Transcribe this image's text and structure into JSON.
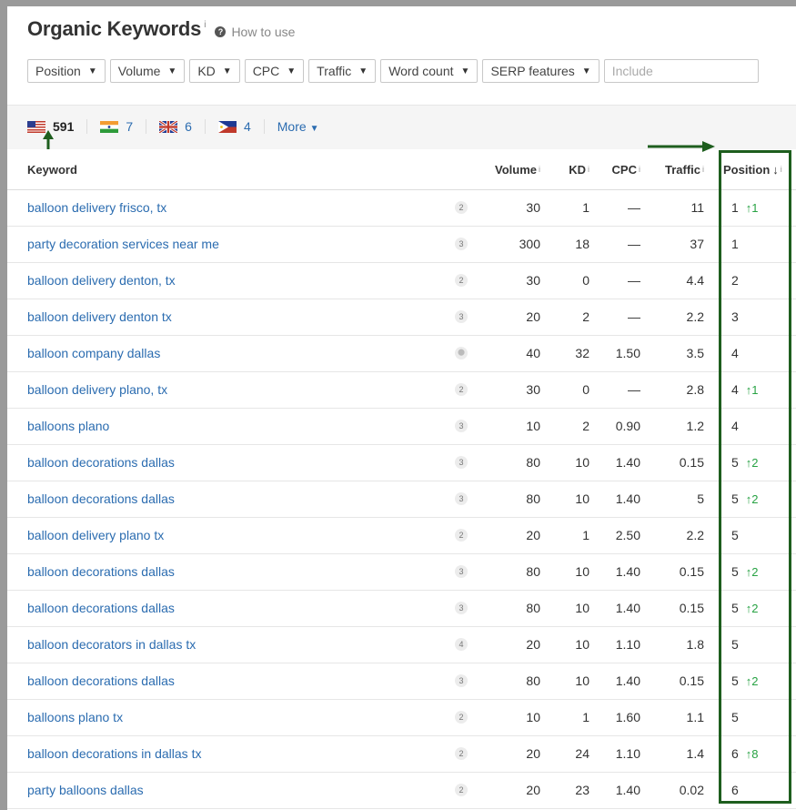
{
  "header": {
    "title": "Organic Keywords",
    "title_sup": "i",
    "help_icon": "?",
    "how_to_use": "How to use"
  },
  "filters": [
    "Position",
    "Volume",
    "KD",
    "CPC",
    "Traffic",
    "Word count",
    "SERP features"
  ],
  "include_placeholder": "Include",
  "countries": [
    {
      "flag": "us-flag-icon",
      "count": "591"
    },
    {
      "flag": "india-flag-icon",
      "count": "7"
    },
    {
      "flag": "uk-flag-icon",
      "count": "6"
    },
    {
      "flag": "philippines-flag-icon",
      "count": "4"
    }
  ],
  "more_label": "More",
  "columns": {
    "keyword": "Keyword",
    "volume": "Volume",
    "kd": "KD",
    "cpc": "CPC",
    "traffic": "Traffic",
    "position": "Position",
    "position_sort": "↓",
    "info": "i"
  },
  "rows": [
    {
      "keyword": "balloon delivery frisco, tx",
      "badge": "2",
      "volume": "30",
      "kd": "1",
      "cpc": "—",
      "traffic": "11",
      "position": "1",
      "change": "↑1"
    },
    {
      "keyword": "party decoration services near me",
      "badge": "3",
      "volume": "300",
      "kd": "18",
      "cpc": "—",
      "traffic": "37",
      "position": "1",
      "change": ""
    },
    {
      "keyword": "balloon delivery denton, tx",
      "badge": "2",
      "volume": "30",
      "kd": "0",
      "cpc": "—",
      "traffic": "4.4",
      "position": "2",
      "change": ""
    },
    {
      "keyword": "balloon delivery denton tx",
      "badge": "3",
      "volume": "20",
      "kd": "2",
      "cpc": "—",
      "traffic": "2.2",
      "position": "3",
      "change": ""
    },
    {
      "keyword": "balloon company dallas",
      "badge": "pin",
      "volume": "40",
      "kd": "32",
      "cpc": "1.50",
      "traffic": "3.5",
      "position": "4",
      "change": ""
    },
    {
      "keyword": "balloon delivery plano, tx",
      "badge": "2",
      "volume": "30",
      "kd": "0",
      "cpc": "—",
      "traffic": "2.8",
      "position": "4",
      "change": "↑1"
    },
    {
      "keyword": "balloons plano",
      "badge": "3",
      "volume": "10",
      "kd": "2",
      "cpc": "0.90",
      "traffic": "1.2",
      "position": "4",
      "change": ""
    },
    {
      "keyword": "balloon decorations dallas",
      "badge": "3",
      "volume": "80",
      "kd": "10",
      "cpc": "1.40",
      "traffic": "0.15",
      "position": "5",
      "change": "↑2"
    },
    {
      "keyword": "balloon decorations dallas",
      "badge": "3",
      "volume": "80",
      "kd": "10",
      "cpc": "1.40",
      "traffic": "5",
      "position": "5",
      "change": "↑2"
    },
    {
      "keyword": "balloon delivery plano tx",
      "badge": "2",
      "volume": "20",
      "kd": "1",
      "cpc": "2.50",
      "traffic": "2.2",
      "position": "5",
      "change": ""
    },
    {
      "keyword": "balloon decorations dallas",
      "badge": "3",
      "volume": "80",
      "kd": "10",
      "cpc": "1.40",
      "traffic": "0.15",
      "position": "5",
      "change": "↑2"
    },
    {
      "keyword": "balloon decorations dallas",
      "badge": "3",
      "volume": "80",
      "kd": "10",
      "cpc": "1.40",
      "traffic": "0.15",
      "position": "5",
      "change": "↑2"
    },
    {
      "keyword": "balloon decorators in dallas tx",
      "badge": "4",
      "volume": "20",
      "kd": "10",
      "cpc": "1.10",
      "traffic": "1.8",
      "position": "5",
      "change": ""
    },
    {
      "keyword": "balloon decorations dallas",
      "badge": "3",
      "volume": "80",
      "kd": "10",
      "cpc": "1.40",
      "traffic": "0.15",
      "position": "5",
      "change": "↑2"
    },
    {
      "keyword": "balloons plano tx",
      "badge": "2",
      "volume": "10",
      "kd": "1",
      "cpc": "1.60",
      "traffic": "1.1",
      "position": "5",
      "change": ""
    },
    {
      "keyword": "balloon decorations in dallas tx",
      "badge": "2",
      "volume": "20",
      "kd": "24",
      "cpc": "1.10",
      "traffic": "1.4",
      "position": "6",
      "change": "↑8"
    },
    {
      "keyword": "party balloons dallas",
      "badge": "2",
      "volume": "20",
      "kd": "23",
      "cpc": "1.40",
      "traffic": "0.02",
      "position": "6",
      "change": ""
    }
  ],
  "colors": {
    "link": "#2b6cb0",
    "up": "#27a243",
    "annotation": "#1e5e1e"
  }
}
